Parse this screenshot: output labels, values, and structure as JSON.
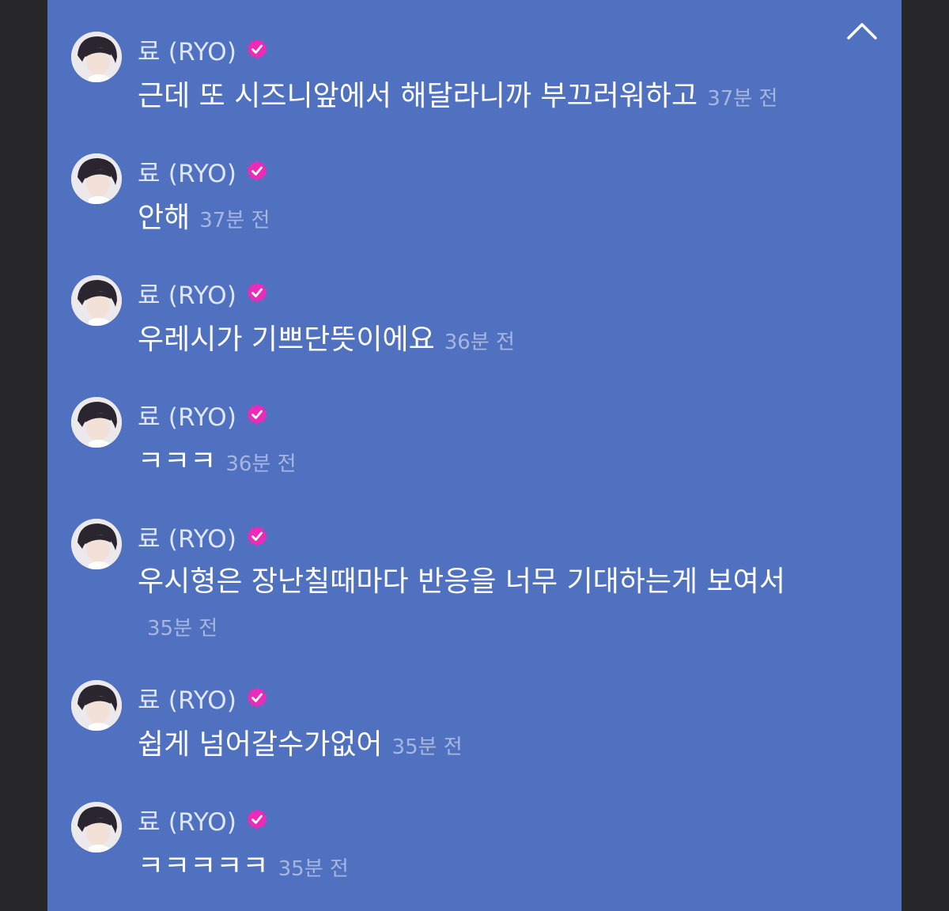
{
  "chat": {
    "collapse_icon": "chevron-up-icon",
    "colors": {
      "panel": "#5071bf",
      "background": "#27272a",
      "verified_badge": "#ee2bb8"
    },
    "messages": [
      {
        "user": "료 (RYO)",
        "text": "근데 또 시즈니앞에서 해달라니까 부끄러워하고",
        "time": "37분 전"
      },
      {
        "user": "료 (RYO)",
        "text": "안해",
        "time": "37분 전"
      },
      {
        "user": "료 (RYO)",
        "text": "우레시가 기쁘단뜻이에요",
        "time": "36분 전"
      },
      {
        "user": "료 (RYO)",
        "text": "ㅋㅋㅋ",
        "time": "36분 전"
      },
      {
        "user": "료 (RYO)",
        "text": "우시형은 장난칠때마다 반응을 너무 기대하는게 보여서",
        "time": "35분 전"
      },
      {
        "user": "료 (RYO)",
        "text": "쉽게 넘어갈수가없어",
        "time": "35분 전"
      },
      {
        "user": "료 (RYO)",
        "text": "ㅋㅋㅋㅋㅋ",
        "time": "35분 전"
      }
    ]
  }
}
